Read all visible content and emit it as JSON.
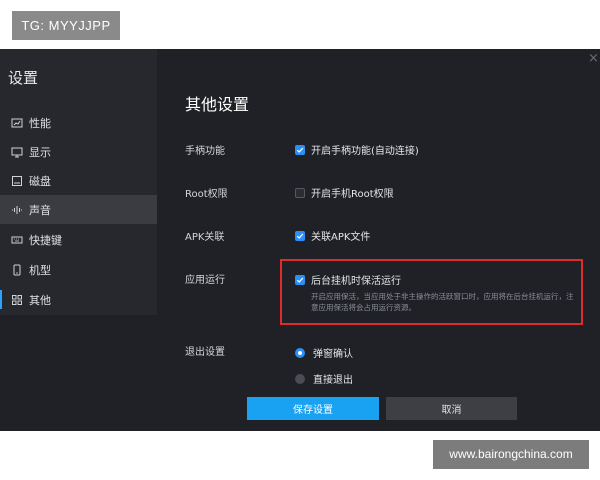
{
  "watermarks": {
    "top_left": "TG: MYYJJPP",
    "bottom_right": "www.bairongchina.com"
  },
  "window": {
    "close_glyph": "×"
  },
  "sidebar": {
    "title": "设置",
    "items": [
      {
        "label": "性能",
        "icon": "performance-icon"
      },
      {
        "label": "显示",
        "icon": "monitor-icon"
      },
      {
        "label": "磁盘",
        "icon": "disk-icon"
      },
      {
        "label": "声音",
        "icon": "sound-wave-icon",
        "hovered": true
      },
      {
        "label": "快捷键",
        "icon": "keyboard-icon"
      },
      {
        "label": "机型",
        "icon": "phone-icon"
      },
      {
        "label": "其他",
        "icon": "grid-icon",
        "active": true
      }
    ],
    "accent": "#2aa3ff"
  },
  "main": {
    "title": "其他设置",
    "rows": {
      "gamepad": {
        "label": "手柄功能",
        "option": "开启手柄功能(自动连接)",
        "checked": true
      },
      "root": {
        "label": "Root权限",
        "option": "开启手机Root权限",
        "checked": false
      },
      "apk": {
        "label": "APK关联",
        "option": "关联APK文件",
        "checked": true
      },
      "background": {
        "label": "应用运行",
        "option": "后台挂机时保活运行",
        "checked": true,
        "description": "开启应用保活，当应用处于非主操作的活跃窗口时，应用将在后台挂机运行，注意应用保活将会占用运行资源。"
      },
      "exit": {
        "label": "退出设置",
        "options": [
          {
            "label": "弹窗确认",
            "selected": true
          },
          {
            "label": "直接退出",
            "selected": false
          }
        ]
      }
    },
    "buttons": {
      "save": "保存设置",
      "cancel": "取消"
    }
  },
  "colors": {
    "accent": "#1aa2f2",
    "highlight_border": "#e02b2b",
    "window_bg": "#1f2126"
  }
}
